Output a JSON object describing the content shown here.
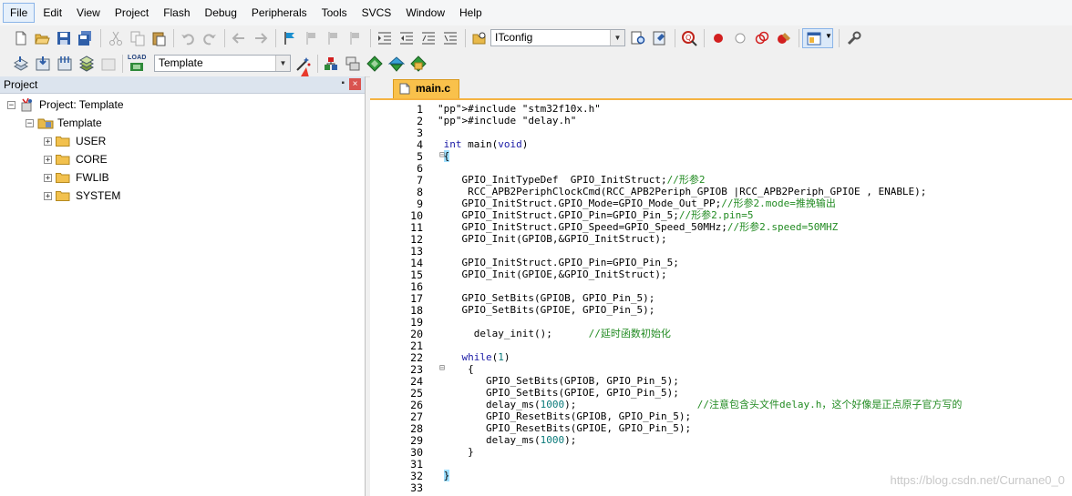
{
  "menu": [
    "File",
    "Edit",
    "View",
    "Project",
    "Flash",
    "Debug",
    "Peripherals",
    "Tools",
    "SVCS",
    "Window",
    "Help"
  ],
  "toolbar1": {
    "config_combo": "ITconfig"
  },
  "toolbar2": {
    "target_combo": "Template",
    "load_label": "LOAD"
  },
  "project_panel": {
    "title": "Project",
    "pin_glyph": "▪",
    "close_glyph": "×",
    "root": "Project: Template",
    "target": "Template",
    "groups": [
      "USER",
      "CORE",
      "FWLIB",
      "SYSTEM"
    ]
  },
  "editor": {
    "tab": "main.c",
    "lines": [
      "#include \"stm32f10x.h\"",
      "#include \"delay.h\"",
      "",
      " int main(void)",
      " {",
      "",
      "    GPIO_InitTypeDef  GPIO_InitStruct;//形参2",
      "     RCC_APB2PeriphClockCmd(RCC_APB2Periph_GPIOB |RCC_APB2Periph_GPIOE , ENABLE);",
      "    GPIO_InitStruct.GPIO_Mode=GPIO_Mode_Out_PP;//形参2.mode=推挽输出",
      "    GPIO_InitStruct.GPIO_Pin=GPIO_Pin_5;//形参2.pin=5",
      "    GPIO_InitStruct.GPIO_Speed=GPIO_Speed_50MHz;//形参2.speed=50MHZ",
      "    GPIO_Init(GPIOB,&GPIO_InitStruct);",
      "",
      "    GPIO_InitStruct.GPIO_Pin=GPIO_Pin_5;",
      "    GPIO_Init(GPIOE,&GPIO_InitStruct);",
      "",
      "    GPIO_SetBits(GPIOB, GPIO_Pin_5);",
      "    GPIO_SetBits(GPIOE, GPIO_Pin_5);",
      "",
      "      delay_init();      //延时函数初始化",
      "",
      "    while(1)",
      "     {",
      "        GPIO_SetBits(GPIOB, GPIO_Pin_5);",
      "        GPIO_SetBits(GPIOE, GPIO_Pin_5);",
      "        delay_ms(1000);                    //注意包含头文件delay.h，这个好像是正点原子官方写的",
      "        GPIO_ResetBits(GPIOB, GPIO_Pin_5);",
      "        GPIO_ResetBits(GPIOE, GPIO_Pin_5);",
      "        delay_ms(1000);",
      "     }",
      "",
      " }",
      ""
    ]
  },
  "watermark": "https://blog.csdn.net/Curnane0_0",
  "colors": {
    "tab_active": "#f9c14b",
    "keyword": "#1a1aa6",
    "string": "#8b1a8b",
    "comment": "#228b22",
    "number": "#0a7a7a",
    "annotation_arrow": "#e8392b"
  }
}
